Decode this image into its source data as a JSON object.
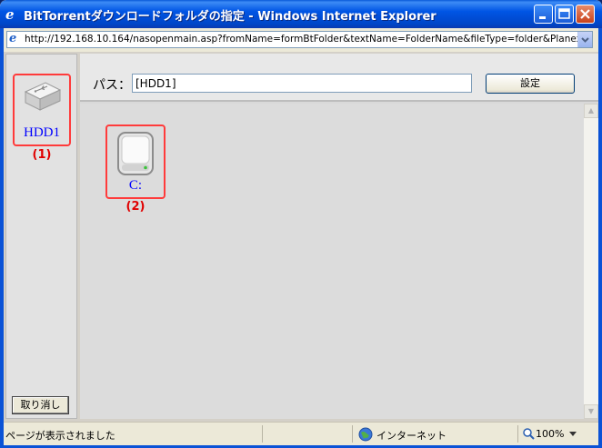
{
  "window": {
    "title": "BitTorrentダウンロードフォルダの指定 - Windows Internet Explorer",
    "url": "http://192.168.10.164/nasopenmain.asp?fromName=formBtFolder&textName=FolderName&fileType=folder&Planex_Windc"
  },
  "left": {
    "device_label": "HDD1",
    "marker": "(1)",
    "cancel_label": "取り消し"
  },
  "path": {
    "label": "パス：",
    "value": "[HDD1]",
    "set_label": "設定"
  },
  "folders": [
    {
      "label": "C:",
      "marker": "(2)"
    }
  ],
  "status": {
    "text": "ページが表示されました",
    "zone": "インターネット",
    "zoom": "100%"
  },
  "colors": {
    "titlebar": "#0055e5",
    "highlight_border": "#ff3b3b",
    "link": "#0000ff",
    "marker": "#e00000"
  },
  "icons": [
    "ie-icon",
    "usb-drive-icon",
    "hard-disk-icon",
    "globe-icon",
    "zoom-icon"
  ]
}
